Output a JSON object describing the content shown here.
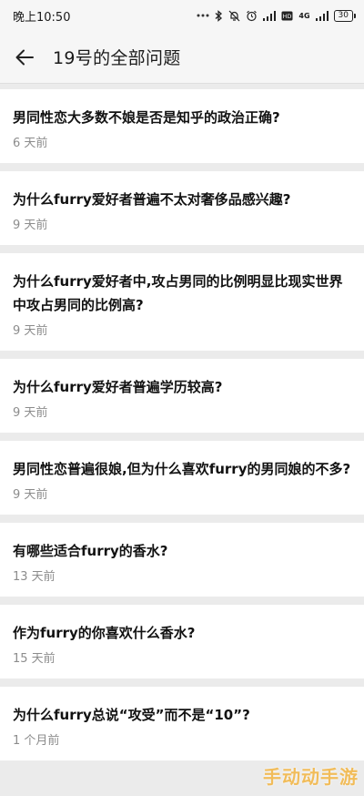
{
  "status_bar": {
    "time": "晚上10:50",
    "network": "4G",
    "battery": "30"
  },
  "header": {
    "title": "19号的全部问题"
  },
  "questions": [
    {
      "title": "男同性恋大多数不娘是否是知乎的政治正确?",
      "time": "6 天前"
    },
    {
      "title": "为什么furry爱好者普遍不太对奢侈品感兴趣?",
      "time": "9 天前"
    },
    {
      "title": "为什么furry爱好者中,攻占男同的比例明显比现实世界中攻占男同的比例高?",
      "time": "9 天前"
    },
    {
      "title": "为什么furry爱好者普遍学历较高?",
      "time": "9 天前"
    },
    {
      "title": "男同性恋普遍很娘,但为什么喜欢furry的男同娘的不多?",
      "time": "9 天前"
    },
    {
      "title": "有哪些适合furry的香水?",
      "time": "13 天前"
    },
    {
      "title": "作为furry的你喜欢什么香水?",
      "time": "15 天前"
    },
    {
      "title": "为什么furry总说“攻受”而不是“10”?",
      "time": "1 个月前"
    }
  ],
  "watermark": "手动动手游"
}
